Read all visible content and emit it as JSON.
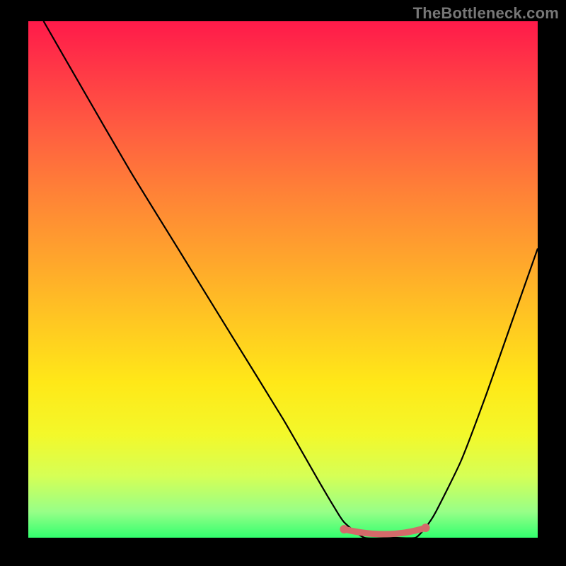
{
  "watermark": "TheBottleneck.com",
  "chart_data": {
    "type": "line",
    "title": "",
    "xlabel": "",
    "ylabel": "",
    "xlim": [
      0,
      100
    ],
    "ylim": [
      0,
      100
    ],
    "grid": false,
    "legend": false,
    "colors": {
      "gradient_top": "#ff1a4a",
      "gradient_mid1": "#ffbf24",
      "gradient_mid2": "#fff010",
      "gradient_bottom": "#32ff6e",
      "curve": "#000000",
      "flat_segment": "#d46a6a",
      "background": "#000000"
    },
    "series": [
      {
        "name": "bottleneck-curve",
        "x": [
          3,
          10,
          20,
          30,
          40,
          50,
          57,
          60,
          62,
          66,
          72,
          76,
          78,
          80,
          85,
          90,
          95,
          100
        ],
        "y": [
          100,
          88,
          71,
          55,
          39,
          23,
          11,
          6,
          3,
          0,
          0,
          0,
          2,
          5,
          15,
          28,
          42,
          56
        ]
      }
    ],
    "flat_region": {
      "x_start": 62,
      "x_end": 78,
      "y": 0
    }
  }
}
